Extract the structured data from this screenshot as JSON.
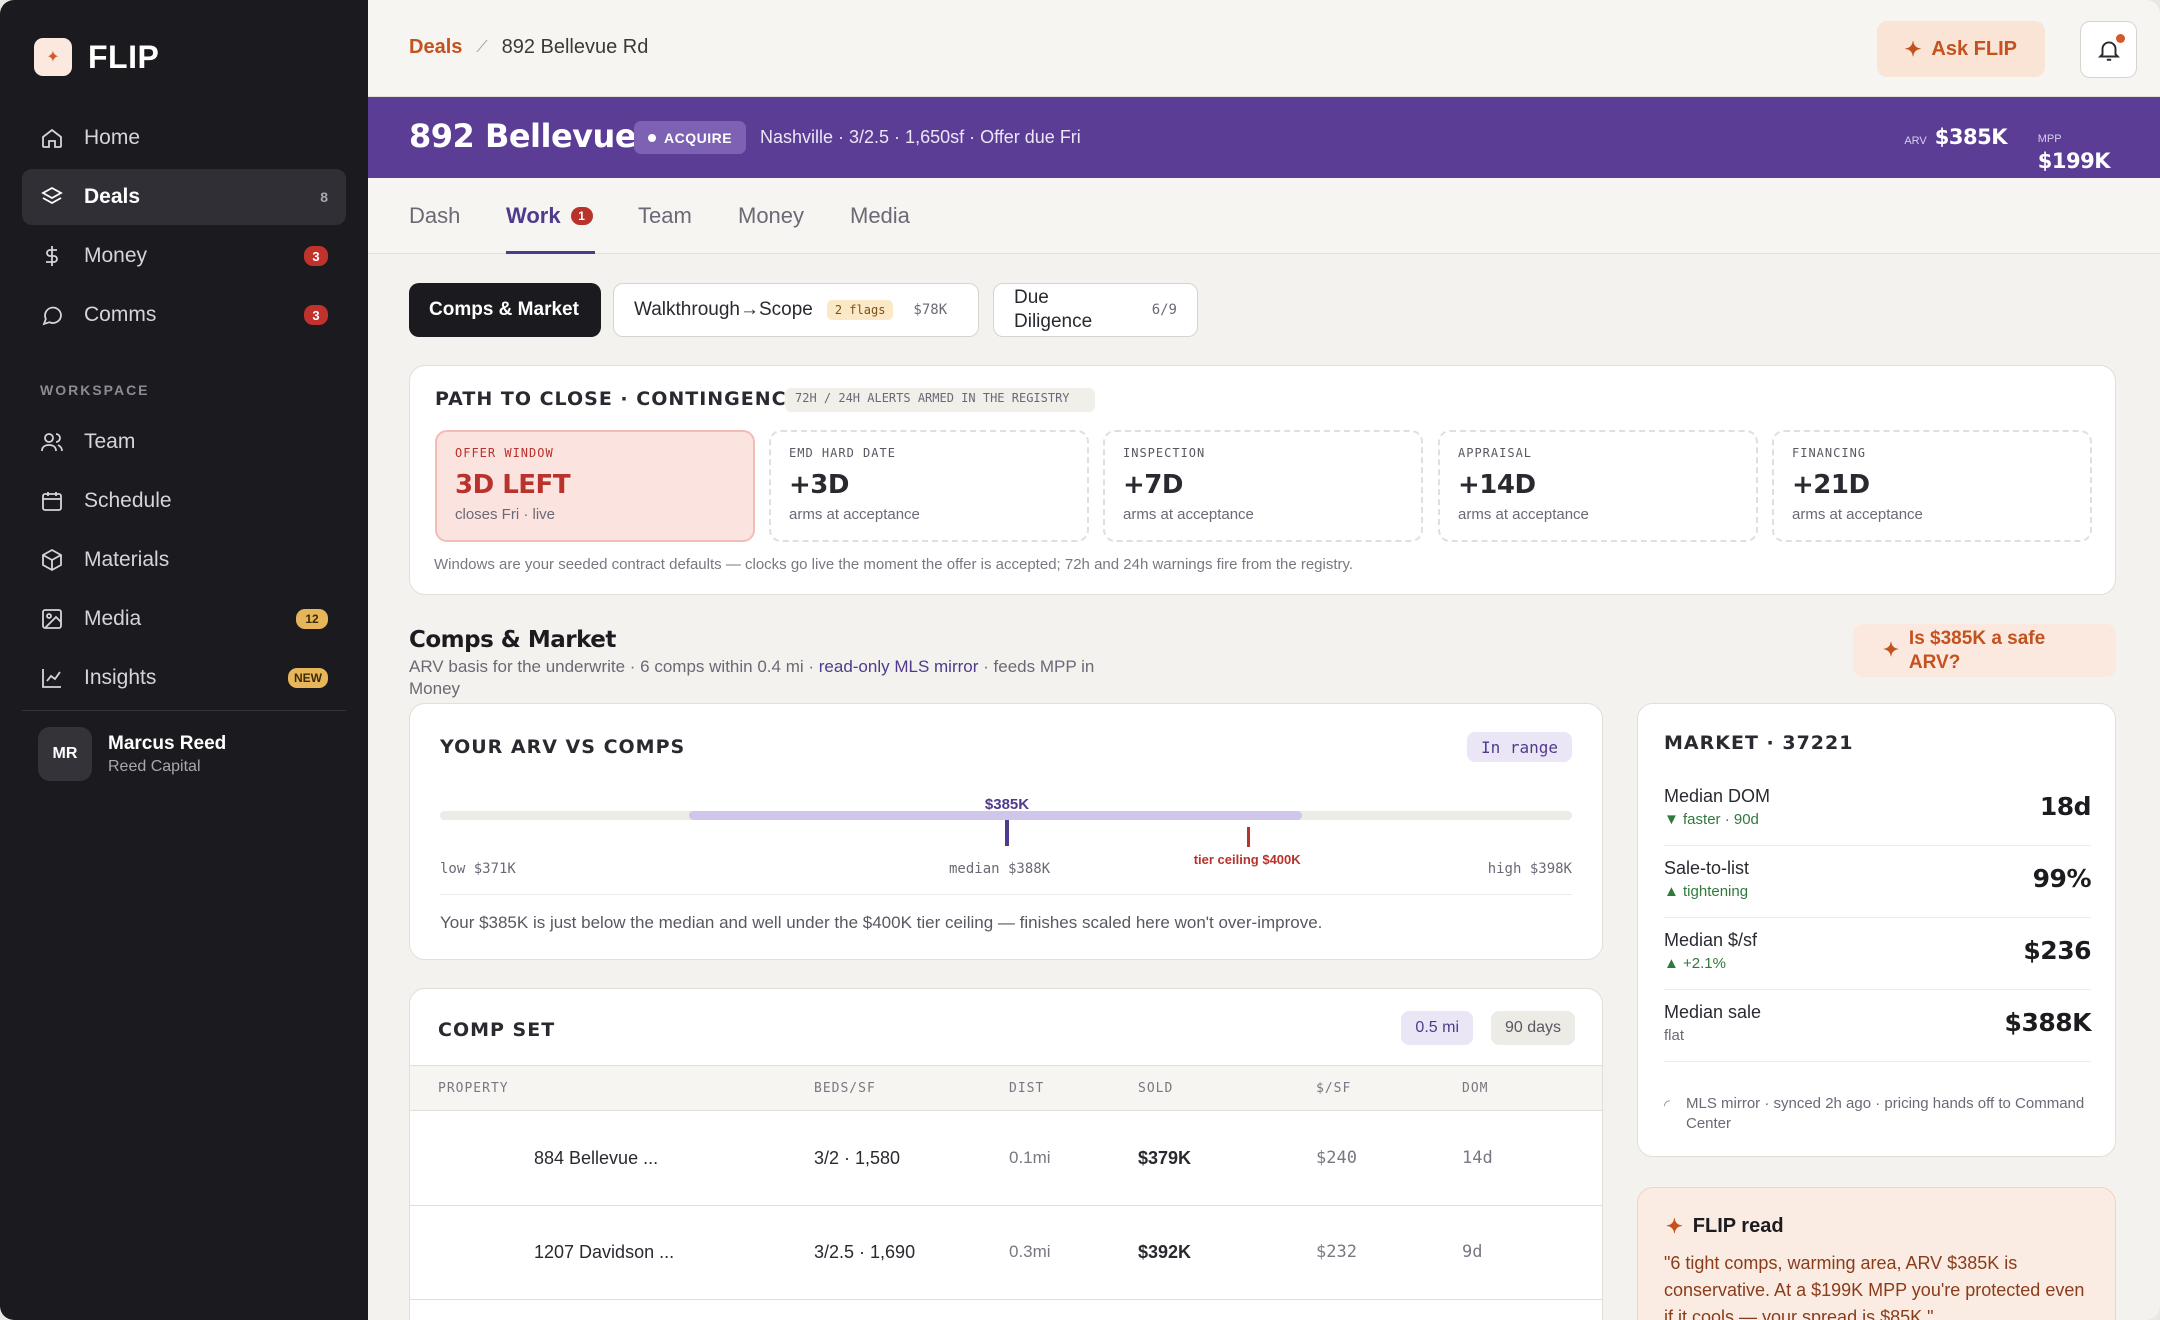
{
  "brand": {
    "name": "FLIP"
  },
  "sidebar": {
    "items": [
      {
        "label": "Home",
        "icon": "home-icon"
      },
      {
        "label": "Deals",
        "icon": "layers-icon",
        "count": "8"
      },
      {
        "label": "Money",
        "icon": "dollar-icon",
        "badge": "3"
      },
      {
        "label": "Comms",
        "icon": "chat-icon",
        "badge": "3"
      }
    ],
    "workspace_label": "WORKSPACE",
    "workspace_items": [
      {
        "label": "Team",
        "icon": "users-icon"
      },
      {
        "label": "Schedule",
        "icon": "calendar-icon"
      },
      {
        "label": "Materials",
        "icon": "box-icon"
      },
      {
        "label": "Media",
        "icon": "image-icon",
        "badge": "12"
      },
      {
        "label": "Insights",
        "icon": "chart-line-icon",
        "badge": "NEW"
      }
    ],
    "user": {
      "initials": "MR",
      "name": "Marcus Reed",
      "org": "Reed Capital"
    }
  },
  "topbar": {
    "breadcrumb_root": "Deals",
    "breadcrumb_current": "892 Bellevue Rd",
    "ask_label": "Ask FLIP"
  },
  "deal": {
    "title": "892 Bellevue Rd",
    "stage": "ACQUIRE",
    "subtitle": "Nashville · 3/2.5 · 1,650sf · Offer due Fri",
    "arv_label": "ARV",
    "arv_value": "$385K",
    "mpp_label": "MPP",
    "mpp_value": "$199K"
  },
  "tabs": [
    {
      "label": "Dash"
    },
    {
      "label": "Work",
      "badge": "1"
    },
    {
      "label": "Team"
    },
    {
      "label": "Money"
    },
    {
      "label": "Media"
    }
  ],
  "subtabs": {
    "comps": "Comps & Market",
    "walkthrough": "Walkthrough→Scope",
    "walkthrough_flags": "2 flags",
    "walkthrough_amount": "$78K",
    "diligence": "Due Diligence",
    "diligence_progress": "6/9"
  },
  "clocks": {
    "title": "PATH TO CLOSE · CONTINGENCY CLOCKS",
    "alert_note": "72H / 24H ALERTS ARMED IN THE REGISTRY",
    "items": [
      {
        "label": "OFFER WINDOW",
        "value": "3D LEFT",
        "sub": "closes Fri · live"
      },
      {
        "label": "EMD HARD DATE",
        "value": "+3D",
        "sub": "arms at acceptance"
      },
      {
        "label": "INSPECTION",
        "value": "+7D",
        "sub": "arms at acceptance"
      },
      {
        "label": "APPRAISAL",
        "value": "+14D",
        "sub": "arms at acceptance"
      },
      {
        "label": "FINANCING",
        "value": "+21D",
        "sub": "arms at acceptance"
      }
    ],
    "note": "Windows are your seeded contract defaults — clocks go live the moment the offer is accepted; 72h and 24h warnings fire from the registry."
  },
  "comps_section": {
    "title": "Comps & Market",
    "sub_a": "ARV basis for the underwrite · 6 comps within 0.4 mi · ",
    "sub_link": "read-only MLS mirror",
    "sub_b": " · feeds MPP in Money",
    "safe_question": "Is $385K a safe ARV?"
  },
  "arv_card": {
    "title": "YOUR ARV VS COMPS",
    "status": "In range",
    "marker_label": "$385K",
    "ceiling_label": "tier ceiling $400K",
    "low_label": "low $371K",
    "median_label": "median $388K",
    "high_label": "high $398K",
    "range_low": 371,
    "range_high": 398,
    "arv": 385,
    "ceiling": 400,
    "note": "Your $385K is just below the median and well under the $400K tier ceiling — finishes scaled here won't over-improve."
  },
  "comp_set": {
    "title": "COMP SET",
    "radius": "0.5 mi",
    "window": "90 days",
    "columns": [
      "PROPERTY",
      "BEDS/SF",
      "DIST",
      "SOLD",
      "$/SF",
      "DOM"
    ],
    "rows": [
      {
        "property": "884 Bellevue ...",
        "beds_sf": "3/2 · 1,580",
        "dist": "0.1mi",
        "sold": "$379K",
        "psf": "$240",
        "dom": "14d"
      },
      {
        "property": "1207 Davidson ...",
        "beds_sf": "3/2.5 · 1,690",
        "dist": "0.3mi",
        "sold": "$392K",
        "psf": "$232",
        "dom": "9d"
      }
    ]
  },
  "market": {
    "title": "MARKET · 37221",
    "rows": [
      {
        "name": "Median DOM",
        "trend": "▼ faster · 90d",
        "value": "18d"
      },
      {
        "name": "Sale-to-list",
        "trend": "▲ tightening",
        "value": "99%"
      },
      {
        "name": "Median $/sf",
        "trend": "▲ +2.1%",
        "value": "$236"
      },
      {
        "name": "Median sale",
        "trend": "flat",
        "value": "$388K"
      }
    ],
    "footer": "MLS mirror · synced 2h ago · pricing hands off to Command Center"
  },
  "flip_read": {
    "title": "FLIP read",
    "body": "\"6 tight comps, warming area, ARV $385K is conservative. At a $199K MPP you're protected even if it cools — your spread is $85K.\""
  },
  "colors": {
    "accent": "#5b3d96",
    "brand": "#c4521e",
    "alert": "#b9322b",
    "sidebar": "#1b1a1f"
  }
}
